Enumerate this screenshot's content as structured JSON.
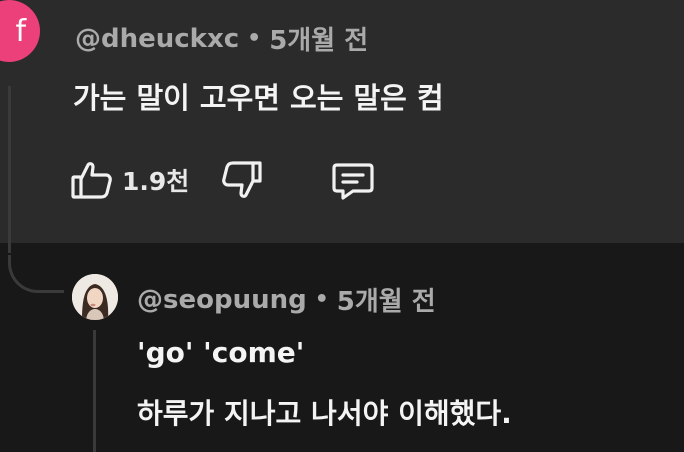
{
  "top_comment": {
    "avatar_letter": "f",
    "avatar_color": "#ec407a",
    "username": "@dheuckxc",
    "separator": "•",
    "time": "5개월 전",
    "text": "가는 말이 고우면 오는 말은 컴",
    "like_count": "1.9천",
    "icons": [
      "thumbs-up-icon",
      "thumbs-down-icon",
      "reply-comment-icon"
    ]
  },
  "reply": {
    "username": "@seopuung",
    "separator": "•",
    "time": "5개월 전",
    "lines": [
      "'go' 'come'",
      "하루가 지나고 나서야 이해했다."
    ]
  }
}
